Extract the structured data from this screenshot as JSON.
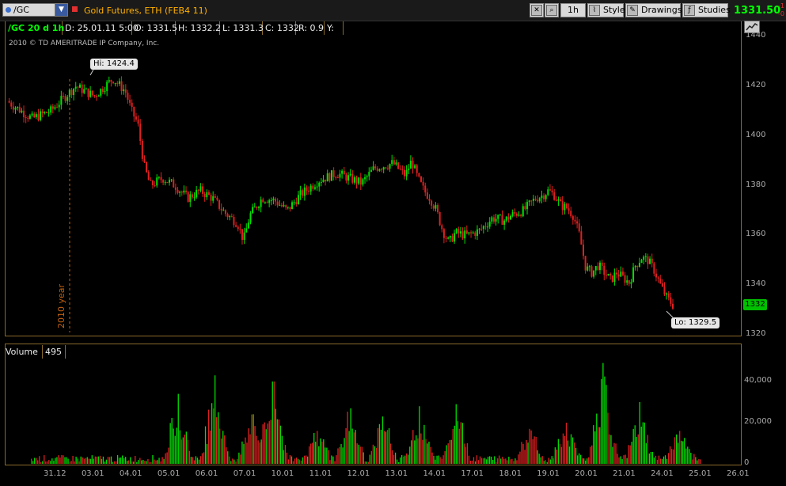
{
  "toolbar": {
    "symbol": "/GC",
    "description": "Gold Futures, ETH (FEB4 11)",
    "timeframe": "1h",
    "style_label": "Style",
    "drawings_label": "Drawings",
    "studies_label": "Studies",
    "last_price": "1331.50",
    "mini_values": [
      "-1",
      "-0"
    ]
  },
  "info": {
    "title": "/GC 20 d 1h",
    "date": "D: 25.01.11 5:00",
    "open": "O: 1331.5",
    "high": "H: 1332.2",
    "low": "L: 1331.3",
    "close": "C: 1332",
    "range": "R: 0.9",
    "y": "Y:"
  },
  "copyright": "2010 © TD AMERITRADE IP Company, Inc.",
  "year_label": "2010 year",
  "price_tag": "1332",
  "hi_label": "Hi: 1424.4",
  "lo_label": "Lo: 1329.5",
  "volume": {
    "label": "Volume",
    "value": "495"
  },
  "colors": {
    "up": "#00e000",
    "down": "#e02020",
    "border": "#8a6a2a",
    "accent": "#00ff00"
  },
  "chart_data": [
    {
      "type": "candlestick",
      "title": "",
      "ylim": [
        1320,
        1440
      ],
      "yticks": [
        "1440",
        "1420",
        "1400",
        "1380",
        "1360",
        "1340",
        "1320"
      ],
      "date_labels": [
        "31.12",
        "03.01",
        "04.01",
        "05.01",
        "06.01",
        "07.01",
        "10.01",
        "11.01",
        "12.01",
        "13.01",
        "14.01",
        "17.01",
        "18.01",
        "19.01",
        "20.01",
        "21.01",
        "24.01",
        "25.01",
        "26.01"
      ],
      "close_path": [
        [
          0,
          1414
        ],
        [
          4,
          1407
        ],
        [
          7,
          1410
        ],
        [
          11,
          1420
        ],
        [
          14,
          1416
        ],
        [
          17,
          1423
        ],
        [
          19,
          1418
        ],
        [
          20,
          1410
        ],
        [
          21,
          1405
        ],
        [
          22,
          1388
        ],
        [
          23,
          1380
        ],
        [
          25,
          1383
        ],
        [
          27,
          1380
        ],
        [
          29,
          1375
        ],
        [
          31,
          1378
        ],
        [
          33,
          1375
        ],
        [
          35,
          1369
        ],
        [
          37,
          1365
        ],
        [
          38,
          1358
        ],
        [
          39,
          1368
        ],
        [
          41,
          1375
        ],
        [
          43,
          1374
        ],
        [
          45,
          1370
        ],
        [
          47,
          1376
        ],
        [
          50,
          1382
        ],
        [
          53,
          1385
        ],
        [
          55,
          1383
        ],
        [
          57,
          1381
        ],
        [
          59,
          1387
        ],
        [
          62,
          1389
        ],
        [
          64,
          1384
        ],
        [
          65,
          1390
        ],
        [
          66,
          1383
        ],
        [
          67,
          1378
        ],
        [
          68,
          1375
        ],
        [
          69,
          1370
        ],
        [
          70,
          1362
        ],
        [
          71,
          1357
        ],
        [
          72,
          1361
        ],
        [
          74,
          1360
        ],
        [
          76,
          1362
        ],
        [
          78,
          1367
        ],
        [
          80,
          1366
        ],
        [
          81,
          1368
        ],
        [
          83,
          1370
        ],
        [
          85,
          1375
        ],
        [
          86,
          1376
        ],
        [
          87,
          1378
        ],
        [
          88,
          1376
        ],
        [
          89,
          1372
        ],
        [
          90,
          1371
        ],
        [
          91,
          1368
        ],
        [
          92,
          1360
        ],
        [
          93,
          1347
        ],
        [
          94,
          1345
        ],
        [
          95,
          1348
        ],
        [
          96,
          1345
        ],
        [
          97,
          1342
        ],
        [
          98,
          1345
        ],
        [
          99,
          1343
        ],
        [
          100,
          1341
        ],
        [
          101,
          1348
        ],
        [
          102,
          1351
        ],
        [
          103,
          1350
        ],
        [
          104,
          1346
        ],
        [
          105,
          1340
        ],
        [
          106,
          1335
        ],
        [
          107,
          1332
        ]
      ],
      "total_units": 107,
      "hi": 1424.4,
      "lo": 1329.5,
      "last": 1332
    },
    {
      "type": "bar",
      "title": "Volume",
      "ylim": [
        0,
        50000
      ],
      "yticks": [
        "40,000",
        "20,000",
        "0"
      ],
      "spikes": [
        {
          "pos": 0.2,
          "value": 34000
        },
        {
          "pos": 0.25,
          "value": 43000
        },
        {
          "pos": 0.3,
          "value": 24000
        },
        {
          "pos": 0.33,
          "value": 40000
        },
        {
          "pos": 0.39,
          "value": 16000
        },
        {
          "pos": 0.435,
          "value": 27000
        },
        {
          "pos": 0.48,
          "value": 23000
        },
        {
          "pos": 0.53,
          "value": 28000
        },
        {
          "pos": 0.58,
          "value": 29000
        },
        {
          "pos": 0.68,
          "value": 17000
        },
        {
          "pos": 0.73,
          "value": 20000
        },
        {
          "pos": 0.78,
          "value": 49000
        },
        {
          "pos": 0.83,
          "value": 30000
        },
        {
          "pos": 0.885,
          "value": 16000
        }
      ]
    }
  ]
}
